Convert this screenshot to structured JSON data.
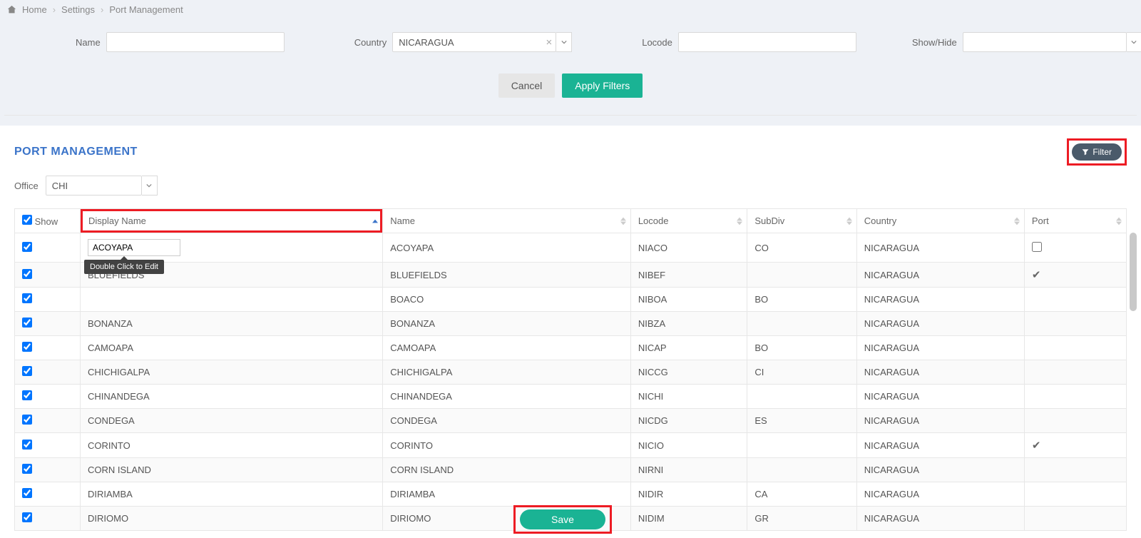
{
  "breadcrumb": {
    "home": "Home",
    "settings": "Settings",
    "current": "Port Management"
  },
  "filters": {
    "name": {
      "label": "Name",
      "value": ""
    },
    "country": {
      "label": "Country",
      "value": "NICARAGUA"
    },
    "locode": {
      "label": "Locode",
      "value": ""
    },
    "showhide": {
      "label": "Show/Hide",
      "value": ""
    }
  },
  "buttons": {
    "cancel": "Cancel",
    "apply": "Apply Filters",
    "filter": "Filter",
    "save": "Save"
  },
  "page": {
    "title": "PORT MANAGEMENT"
  },
  "office": {
    "label": "Office",
    "value": "CHI"
  },
  "tooltip": "Double Click to Edit",
  "table": {
    "headers": {
      "show": "Show",
      "display": "Display Name",
      "name": "Name",
      "locode": "Locode",
      "subdiv": "SubDiv",
      "country": "Country",
      "port": "Port"
    },
    "rows": [
      {
        "show": true,
        "displayEdit": true,
        "display": "ACOYAPA",
        "name": "ACOYAPA",
        "locode": "NIACO",
        "subdiv": "CO",
        "country": "NICARAGUA",
        "port": "unchecked"
      },
      {
        "show": true,
        "display": "BLUEFIELDS",
        "name": "BLUEFIELDS",
        "locode": "NIBEF",
        "subdiv": "",
        "country": "NICARAGUA",
        "port": "check"
      },
      {
        "show": true,
        "display": "",
        "name": "BOACO",
        "locode": "NIBOA",
        "subdiv": "BO",
        "country": "NICARAGUA",
        "port": ""
      },
      {
        "show": true,
        "display": "BONANZA",
        "name": "BONANZA",
        "locode": "NIBZA",
        "subdiv": "",
        "country": "NICARAGUA",
        "port": ""
      },
      {
        "show": true,
        "display": "CAMOAPA",
        "name": "CAMOAPA",
        "locode": "NICAP",
        "subdiv": "BO",
        "country": "NICARAGUA",
        "port": ""
      },
      {
        "show": true,
        "display": "CHICHIGALPA",
        "name": "CHICHIGALPA",
        "locode": "NICCG",
        "subdiv": "CI",
        "country": "NICARAGUA",
        "port": ""
      },
      {
        "show": true,
        "display": "CHINANDEGA",
        "name": "CHINANDEGA",
        "locode": "NICHI",
        "subdiv": "",
        "country": "NICARAGUA",
        "port": ""
      },
      {
        "show": true,
        "display": "CONDEGA",
        "name": "CONDEGA",
        "locode": "NICDG",
        "subdiv": "ES",
        "country": "NICARAGUA",
        "port": ""
      },
      {
        "show": true,
        "display": "CORINTO",
        "name": "CORINTO",
        "locode": "NICIO",
        "subdiv": "",
        "country": "NICARAGUA",
        "port": "check"
      },
      {
        "show": true,
        "display": "CORN ISLAND",
        "name": "CORN ISLAND",
        "locode": "NIRNI",
        "subdiv": "",
        "country": "NICARAGUA",
        "port": ""
      },
      {
        "show": true,
        "display": "DIRIAMBA",
        "name": "DIRIAMBA",
        "locode": "NIDIR",
        "subdiv": "CA",
        "country": "NICARAGUA",
        "port": ""
      },
      {
        "show": true,
        "display": "DIRIOMO",
        "name": "DIRIOMO",
        "locode": "NIDIM",
        "subdiv": "GR",
        "country": "NICARAGUA",
        "port": ""
      }
    ]
  }
}
